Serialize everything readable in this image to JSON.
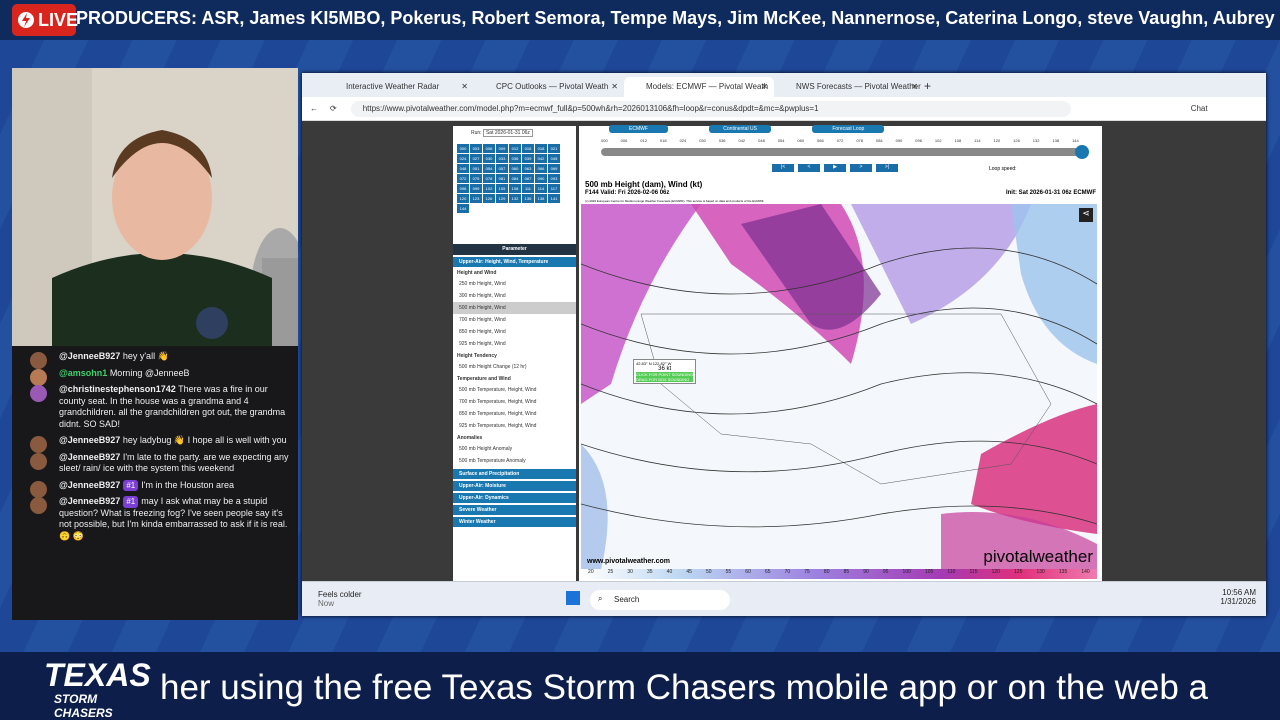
{
  "live_label": "LIVE",
  "producers": "PRODUCERS: ASR, James KI5MBO, Pokerus, Robert Semora, Tempe Mays, Jim McKee, Nannernose, Caterina Longo, steve Vaughn, Aubrey",
  "chat": [
    {
      "user": "@JenneeB927",
      "text": "hey y'all 👋"
    },
    {
      "user": "@amsohn1",
      "text": "Morning @JenneeB"
    },
    {
      "user": "@christinestephenson1742",
      "text": "There was a fire in our county seat. In the house was a grandma and 4 grandchildren. all the grandchildren got out, the grandma didnt. SO SAD!"
    },
    {
      "user": "@JenneeB927",
      "text": "hey ladybug 👋 I hope all is well with you"
    },
    {
      "user": "@JenneeB927",
      "text": "I'm late to the party. are we expecting any sleet/ rain/ ice with the system this weekend"
    },
    {
      "user": "@JenneeB927",
      "badge": "#1",
      "text": "I'm in the Houston area"
    },
    {
      "user": "@JenneeB927",
      "badge": "#1",
      "text": "may I ask what may be a stupid question? What is freezing fog? I've seen people say it's not possible, but I'm kinda embarrassed to ask if it is real. 🙃 😳"
    }
  ],
  "browser": {
    "tabs": [
      "Interactive Weather Radar",
      "CPC Outlooks — Pivotal Weath",
      "Models: ECMWF — Pivotal Weath",
      "NWS Forecasts — Pivotal Weather"
    ],
    "url": "https://www.pivotalweather.com/model.php?m=ecmwf_full&p=500wh&rh=2026013106&fh=loop&r=conus&dpdt=&mc=&pwplus=1",
    "chat_label": "Chat"
  },
  "sidebar": {
    "forecast_hour": "Forecast Hour",
    "run_label": "Run:",
    "run_value": "Sat 2026-01-31 06z",
    "hours": [
      "000",
      "003",
      "006",
      "009",
      "012",
      "015",
      "018",
      "021",
      "024",
      "027",
      "030",
      "033",
      "036",
      "039",
      "042",
      "045",
      "048",
      "051",
      "054",
      "057",
      "060",
      "063",
      "066",
      "069",
      "072",
      "075",
      "078",
      "081",
      "084",
      "087",
      "090",
      "093",
      "096",
      "099",
      "102",
      "105",
      "108",
      "111",
      "114",
      "117",
      "120",
      "123",
      "126",
      "129",
      "132",
      "135",
      "138",
      "141",
      "144"
    ],
    "parameter": "Parameter",
    "upper_air": "Upper-Air: Height, Wind, Temperature",
    "height_wind": "Height and Wind",
    "hw_items": [
      "250 mb Height, Wind",
      "300 mb Height, Wind",
      "500 mb Height, Wind",
      "700 mb Height, Wind",
      "850 mb Height, Wind",
      "925 mb Height, Wind"
    ],
    "height_tendency": "Height Tendency",
    "ht_items": [
      "500 mb Height Change (12 hr)"
    ],
    "temp_wind": "Temperature and Wind",
    "tw_items": [
      "500 mb Temperature, Height, Wind",
      "700 mb Temperature, Height, Wind",
      "850 mb Temperature, Height, Wind",
      "925 mb Temperature, Height, Wind"
    ],
    "anomalies": "Anomalies",
    "an_items": [
      "500 mb Height Anomaly",
      "500 mb Temperature Anomaly"
    ],
    "categories": [
      "Surface and Precipitation",
      "Upper-Air: Moisture",
      "Upper-Air: Dynamics",
      "Severe Weather",
      "Winter Weather"
    ]
  },
  "toolbar": {
    "model": "ECMWF",
    "region": "Continental US",
    "loop": "Forecast Loop",
    "loop_speed": "Loop speed:"
  },
  "loop_hours": [
    "000",
    "006",
    "012",
    "018",
    "024",
    "030",
    "036",
    "042",
    "048",
    "054",
    "060",
    "066",
    "072",
    "078",
    "084",
    "090",
    "096",
    "102",
    "108",
    "114",
    "120",
    "126",
    "132",
    "138",
    "144"
  ],
  "map": {
    "title": "500 mb Height (dam), Wind (kt)",
    "valid": "F144 Valid: Fri 2026-02-06 06z",
    "init": "Init: Sat 2026-01-31 06z ECMWF",
    "credit": "(c) 2026 European Centre for Medium-range Weather Forecasts (ECMWF). This service is based on data and products of the ECMWF.",
    "tooltip_coords": "42.83° N 122.82° W",
    "tooltip_value": "36 kt",
    "tooltip_hint": "CLICK FOR POINT SOUNDING\nDRAG FOR BOX SOUNDING",
    "watermark": "pivotalweather",
    "site": "www.pivotalweather.com",
    "scale": [
      "20",
      "25",
      "30",
      "35",
      "40",
      "45",
      "50",
      "55",
      "60",
      "65",
      "70",
      "75",
      "80",
      "85",
      "90",
      "95",
      "100",
      "105",
      "110",
      "115",
      "120",
      "125",
      "130",
      "135",
      "140"
    ]
  },
  "taskbar": {
    "notif_title": "Feels colder",
    "notif_sub": "Now",
    "search": "Search",
    "time": "10:56 AM",
    "date": "1/31/2026"
  },
  "ticker": "her using the free Texas Storm Chasers mobile app or on the web a",
  "brand_top": "TEXAS",
  "brand_bottom": "STORM CHASERS"
}
